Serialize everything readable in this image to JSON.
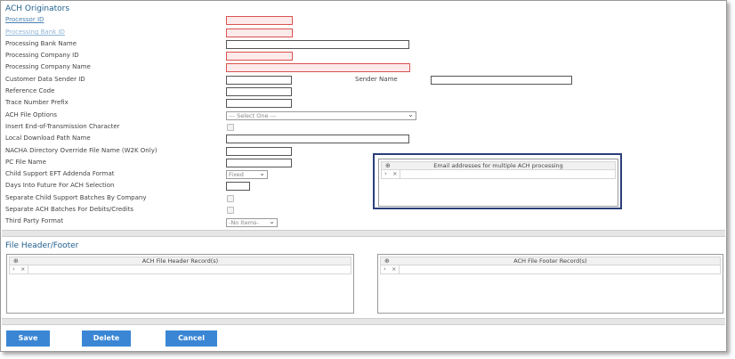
{
  "ach_originators": {
    "title": "ACH Originators",
    "fields": {
      "processor_id": "Processor ID",
      "processing_bank_id": "Processing Bank ID",
      "processing_bank_name": "Processing Bank Name",
      "processing_company_id": "Processing Company ID",
      "processing_company_name": "Processing Company Name",
      "customer_data_sender_id": "Customer Data Sender ID",
      "sender_name": "Sender Name",
      "reference_code": "Reference Code",
      "trace_number_prefix": "Trace Number Prefix",
      "ach_file_options": "ACH File Options",
      "ach_file_options_value": "--- Select One ---",
      "insert_eot_char": "Insert End-of-Transmission Character",
      "local_download_path": "Local Download Path Name",
      "nacha_override": "NACHA Directory Override File Name (W2K Only)",
      "pc_file_name": "PC File Name",
      "child_support_eft": "Child Support EFT Addenda Format",
      "child_support_eft_value": "Fixed",
      "days_into_future": "Days Into Future For ACH Selection",
      "separate_child_support": "Separate Child Support Batches By Company",
      "separate_ach_batches": "Separate ACH Batches For Debits/Credits",
      "third_party_format": "Third Party Format",
      "third_party_format_value": "-No Items-"
    },
    "email_grid": {
      "header": "Email addresses for multiple ACH processing"
    }
  },
  "file_header_footer": {
    "title": "File Header/Footer",
    "header_grid": {
      "header": "ACH File Header Record(s)"
    },
    "footer_grid": {
      "header": "ACH File Footer Record(s)"
    }
  },
  "buttons": {
    "save": "Save",
    "delete": "Delete",
    "cancel": "Cancel"
  },
  "icons": {
    "add": "⊕",
    "expand": "›",
    "remove": "×",
    "dropdown": "⌄"
  },
  "colors": {
    "accent": "#3a86d4",
    "title": "#1f5e8c",
    "highlight_border": "#2a3f7a",
    "required_border": "#d9534f"
  }
}
